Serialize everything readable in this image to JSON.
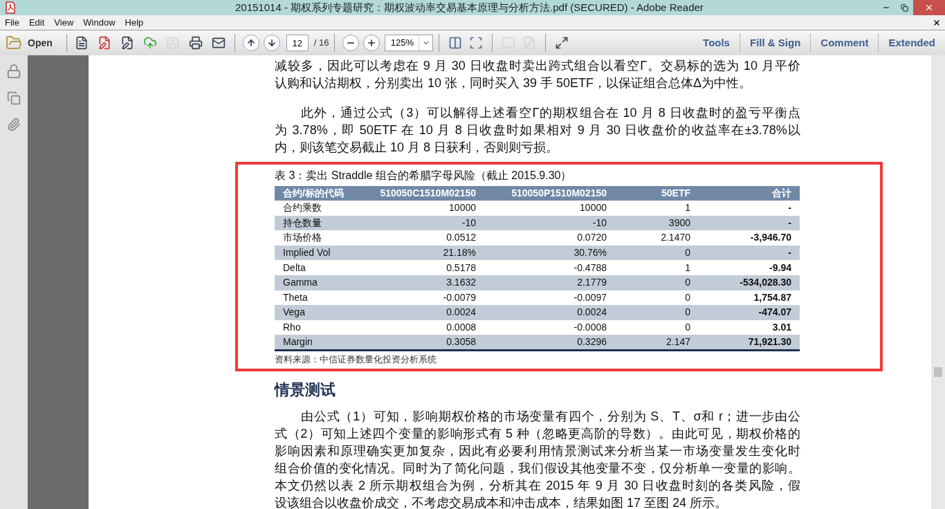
{
  "window": {
    "title": "20151014 - 期权系列专题研究：期权波动率交易基本原理与分析方法.pdf (SECURED) - Adobe Reader"
  },
  "menu": [
    "File",
    "Edit",
    "View",
    "Window",
    "Help"
  ],
  "toolbar": {
    "open": "Open",
    "page": "12",
    "page_total": "/ 16",
    "zoom": "125%",
    "panels": [
      "Tools",
      "Fill & Sign",
      "Comment",
      "Extended"
    ]
  },
  "document": {
    "paragraphs_top": [
      {
        "indent": false,
        "lines": [
          "减较多，因此可以考虑在 9 月 30 日收盘时卖出跨式组合以看空Γ。交易标的选为 10 月平价",
          "认购和认沽期权，分别卖出 10 张，同时买入 39 手 50ETF，以保证组合总体Δ为中性。"
        ]
      },
      {
        "indent": true,
        "lines": [
          "此外，通过公式（3）可以解得上述看空Γ的期权组合在 10 月 8 日收盘时的盈亏平衡点",
          "为 3.78%，即 50ETF 在 10 月 8 日收盘时如果相对 9 月 30 日收盘价的收益率在±3.78%以",
          "内，则该笔交易截止 10 月 8 日获利，否则则亏损。"
        ]
      }
    ],
    "table": {
      "caption": "表 3：卖出 Straddle 组合的希腊字母风险（截止 2015.9.30）",
      "columns": [
        "合约/标的代码",
        "510050C1510M02150",
        "510050P1510M02150",
        "50ETF",
        "合计"
      ],
      "rows": [
        [
          "合约乘数",
          "10000",
          "10000",
          "1",
          "-"
        ],
        [
          "持仓数量",
          "-10",
          "-10",
          "3900",
          "-"
        ],
        [
          "市场价格",
          "0.0512",
          "0.0720",
          "2.1470",
          "-3,946.70"
        ],
        [
          "Implied Vol",
          "21.18%",
          "30.76%",
          "0",
          "-"
        ],
        [
          "Delta",
          "0.5178",
          "-0.4788",
          "1",
          "-9.94"
        ],
        [
          "Gamma",
          "3.1632",
          "2.1779",
          "0",
          "-534,028.30"
        ],
        [
          "Theta",
          "-0.0079",
          "-0.0097",
          "0",
          "1,754.87"
        ],
        [
          "Vega",
          "0.0024",
          "0.0024",
          "0",
          "-474.07"
        ],
        [
          "Rho",
          "0.0008",
          "-0.0008",
          "0",
          "3.01"
        ],
        [
          "Margin",
          "0.3058",
          "0.3296",
          "2.147",
          "71,921.30"
        ]
      ],
      "source": "资料来源：中信证券数量化投资分析系统"
    },
    "heading": "情景测试",
    "paragraphs_bottom": [
      {
        "indent": true,
        "lines": [
          "由公式（1）可知，影响期权价格的市场变量有四个，分别为 S、T、σ和 r；进一步由公",
          "式（2）可知上述四个变量的影响形式有 5 种（忽略更高阶的导数）。由此可见，期权价格的",
          "影响因素和原理确实更加复杂，因此有必要利用情景测试来分析当某一市场变量发生变化时",
          "组合价值的变化情况。同时为了简化问题，我们假设其他变量不变，仅分析单一变量的影响。",
          "本文仍然以表 2 所示期权组合为例，分析其在 2015 年 9 月 30 日收盘时刻的各类风险，假",
          "设该组合以收盘价成交，不考虑交易成本和冲击成本，结果如图 17 至图 24 所示。"
        ]
      }
    ]
  }
}
